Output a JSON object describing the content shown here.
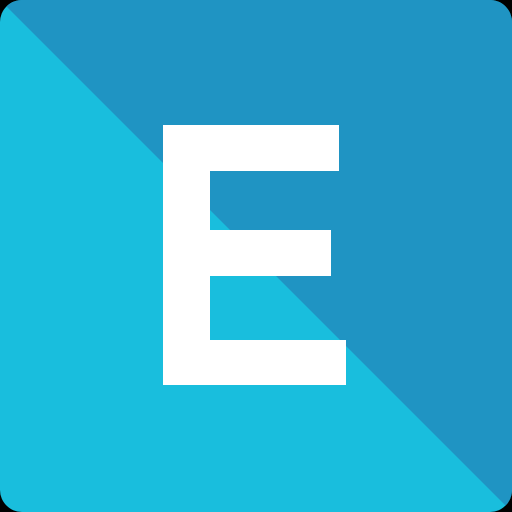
{
  "icon": {
    "letter": "E",
    "colors": {
      "light": "#19bedd",
      "dark": "#1f94c3",
      "letter": "#ffffff",
      "frame": "#000000"
    }
  }
}
